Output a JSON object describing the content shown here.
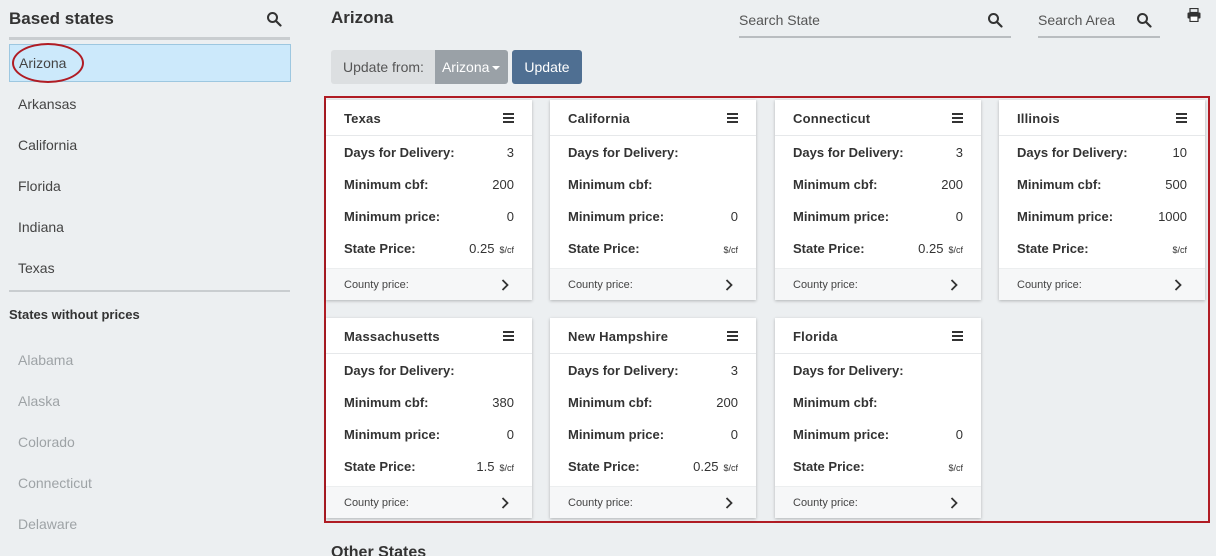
{
  "sidebar": {
    "title": "Based states",
    "based_states": [
      "Arizona",
      "Arkansas",
      "California",
      "Florida",
      "Indiana",
      "Texas"
    ],
    "active_state": "Arizona",
    "subtitle": "States without prices",
    "states_without_prices": [
      "Alabama",
      "Alaska",
      "Colorado",
      "Connecticut",
      "Delaware"
    ]
  },
  "main": {
    "title": "Arizona",
    "search_state_placeholder": "Search State",
    "search_area_placeholder": "Search Area",
    "update_from_label": "Update from:",
    "update_from_value": "Arizona",
    "update_button": "Update",
    "other_states_heading": "Other States"
  },
  "labels": {
    "days": "Days for Delivery:",
    "min_cbf": "Minimum cbf:",
    "min_price": "Minimum price:",
    "state_price": "State Price:",
    "unit": "$/cf",
    "county_price": "County price:"
  },
  "cards": [
    {
      "state": "Texas",
      "days": "3",
      "min_cbf": "200",
      "min_price": "0",
      "state_price": "0.25"
    },
    {
      "state": "California",
      "days": "",
      "min_cbf": "",
      "min_price": "0",
      "state_price": ""
    },
    {
      "state": "Connecticut",
      "days": "3",
      "min_cbf": "200",
      "min_price": "0",
      "state_price": "0.25"
    },
    {
      "state": "Illinois",
      "days": "10",
      "min_cbf": "500",
      "min_price": "1000",
      "state_price": ""
    },
    {
      "state": "Massachusetts",
      "days": "",
      "min_cbf": "380",
      "min_price": "0",
      "state_price": "1.5"
    },
    {
      "state": "New Hampshire",
      "days": "3",
      "min_cbf": "200",
      "min_price": "0",
      "state_price": "0.25"
    },
    {
      "state": "Florida",
      "days": "",
      "min_cbf": "",
      "min_price": "0",
      "state_price": ""
    }
  ],
  "colors": {
    "accent_red": "#b01c24",
    "active_bg": "#cce9fb",
    "update_button": "#4f6f92",
    "select_bg": "#9aa1a7"
  },
  "icons": {
    "search": "search-icon",
    "print": "print-icon",
    "menu": "hamburger-menu-icon",
    "chevron": "chevron-right-icon"
  }
}
